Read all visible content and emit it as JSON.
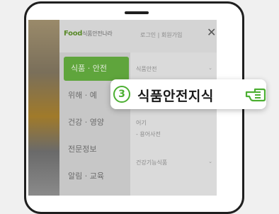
{
  "header": {
    "logo_main": "Food",
    "logo_rest": "식품안전나라",
    "links": "로그인 | 회원가입",
    "close_icon": "close-icon"
  },
  "left_menu": {
    "items": [
      {
        "label": "식품 · 안전",
        "active": true
      },
      {
        "label": "위해 · 예"
      },
      {
        "label": "건강 · 영양"
      },
      {
        "label": "전문정보"
      },
      {
        "label": "알림 · 교육"
      }
    ]
  },
  "right_pane": {
    "items": [
      {
        "label": "식품안전"
      },
      {
        "label": "어기"
      },
      {
        "label": "- 용어사전"
      },
      {
        "label": "건강기능식품"
      }
    ]
  },
  "callout": {
    "badge": "3",
    "label": "식품안전지식",
    "icon": "pointing-hand-icon"
  },
  "colors": {
    "accent": "#4caf32",
    "active_menu": "#5fa53c"
  }
}
